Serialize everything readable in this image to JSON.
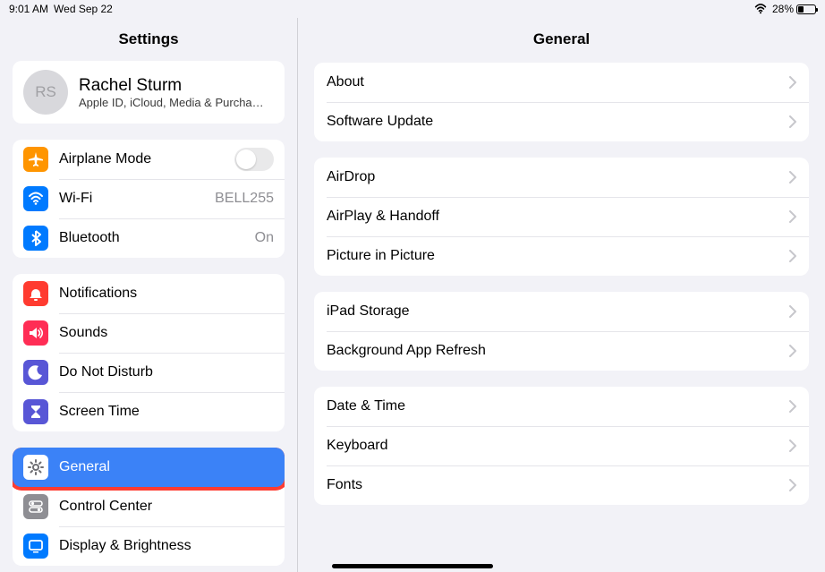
{
  "status": {
    "time": "9:01 AM",
    "date": "Wed Sep 22",
    "battery_pct": "28%"
  },
  "sidebar": {
    "title": "Settings",
    "profile": {
      "initials": "RS",
      "name": "Rachel Sturm",
      "subtitle": "Apple ID, iCloud, Media & Purcha…"
    },
    "group1": [
      {
        "id": "airplane",
        "label": "Airplane Mode",
        "icon": "airplane-icon",
        "bg": "#ff9500",
        "type": "toggle",
        "on": false
      },
      {
        "id": "wifi",
        "label": "Wi-Fi",
        "icon": "wifi-icon",
        "bg": "#007aff",
        "type": "value",
        "value": "BELL255"
      },
      {
        "id": "bluetooth",
        "label": "Bluetooth",
        "icon": "bluetooth-icon",
        "bg": "#007aff",
        "type": "value",
        "value": "On"
      }
    ],
    "group2": [
      {
        "id": "notifications",
        "label": "Notifications",
        "icon": "bell-icon",
        "bg": "#ff3b30"
      },
      {
        "id": "sounds",
        "label": "Sounds",
        "icon": "speaker-icon",
        "bg": "#ff2d55"
      },
      {
        "id": "dnd",
        "label": "Do Not Disturb",
        "icon": "moon-icon",
        "bg": "#5856d6"
      },
      {
        "id": "screentime",
        "label": "Screen Time",
        "icon": "hourglass-icon",
        "bg": "#5856d6"
      }
    ],
    "group3": [
      {
        "id": "general",
        "label": "General",
        "icon": "gear-icon",
        "bg": "#8e8e93",
        "selected": true,
        "highlight": true
      },
      {
        "id": "controlcenter",
        "label": "Control Center",
        "icon": "switches-icon",
        "bg": "#8e8e93"
      },
      {
        "id": "display",
        "label": "Display & Brightness",
        "icon": "display-icon",
        "bg": "#007aff"
      }
    ]
  },
  "detail": {
    "title": "General",
    "sections": [
      [
        {
          "id": "about",
          "label": "About"
        },
        {
          "id": "software-update",
          "label": "Software Update"
        }
      ],
      [
        {
          "id": "airdrop",
          "label": "AirDrop"
        },
        {
          "id": "airplay-handoff",
          "label": "AirPlay & Handoff"
        },
        {
          "id": "pip",
          "label": "Picture in Picture"
        }
      ],
      [
        {
          "id": "ipad-storage",
          "label": "iPad Storage"
        },
        {
          "id": "background-refresh",
          "label": "Background App Refresh"
        }
      ],
      [
        {
          "id": "date-time",
          "label": "Date & Time"
        },
        {
          "id": "keyboard",
          "label": "Keyboard"
        },
        {
          "id": "fonts",
          "label": "Fonts"
        }
      ]
    ]
  }
}
